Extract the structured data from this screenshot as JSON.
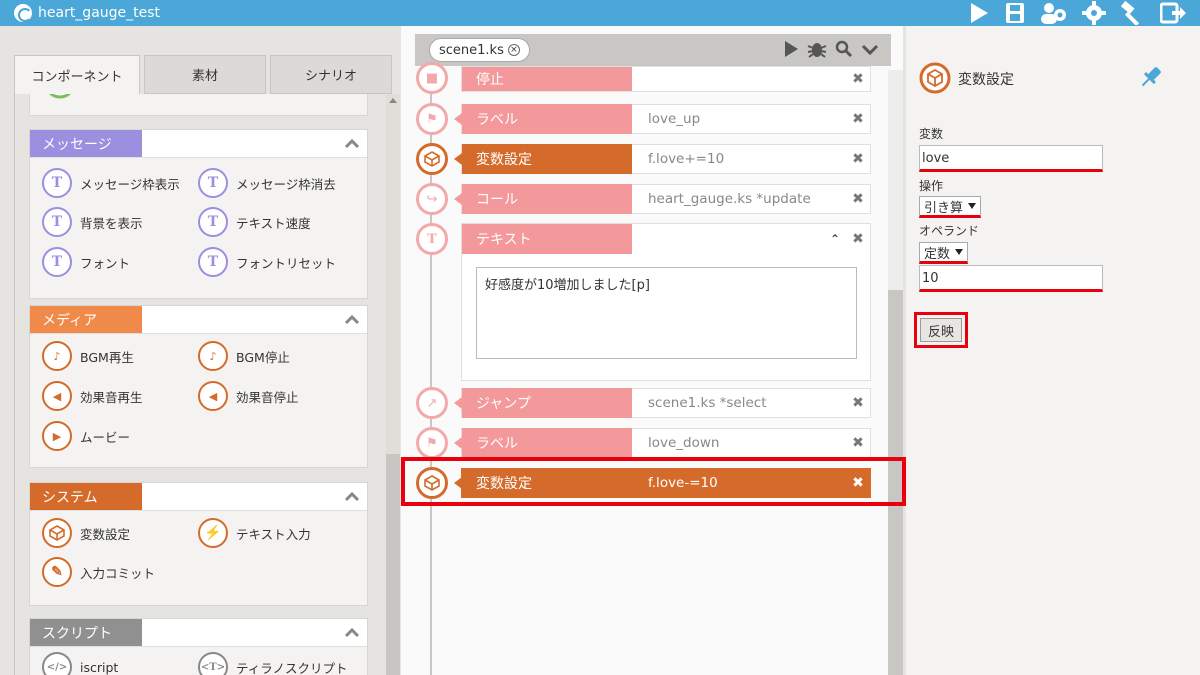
{
  "app": {
    "title": "heart_gauge_test"
  },
  "toolbar_icons": [
    "play-icon",
    "save-icon",
    "users-icon",
    "gear-icon",
    "hammer-icon",
    "export-icon"
  ],
  "left": {
    "tabs": [
      "コンポーネント",
      "素材",
      "シナリオ"
    ],
    "groups": [
      {
        "name": "message",
        "label": "メッセージ",
        "color": "#9b8fe0",
        "items": [
          "メッセージ枠表示",
          "メッセージ枠消去",
          "背景を表示",
          "テキスト速度",
          "フォント",
          "フォントリセット"
        ]
      },
      {
        "name": "media",
        "label": "メディア",
        "color": "#f08a4b",
        "items": [
          "BGM再生",
          "BGM停止",
          "効果音再生",
          "効果音停止",
          "ムービー"
        ]
      },
      {
        "name": "system",
        "label": "システム",
        "color": "#d56b2b",
        "items": [
          "変数設定",
          "テキスト入力",
          "入力コミット"
        ]
      },
      {
        "name": "script",
        "label": "スクリプト",
        "color": "#909090",
        "items": [
          "iscript",
          "ティラノスクリプト"
        ]
      }
    ]
  },
  "editor": {
    "file_tab": "scene1.ks",
    "rows": [
      {
        "label": "停止",
        "value": ""
      },
      {
        "label": "ラベル",
        "value": "love_up"
      },
      {
        "label": "変数設定",
        "value": "f.love+=10"
      },
      {
        "label": "コール",
        "value": "heart_gauge.ks *update"
      },
      {
        "label": "テキスト",
        "value": "好感度が10増加しました[p]"
      },
      {
        "label": "ジャンプ",
        "value": "scene1.ks *select"
      },
      {
        "label": "ラベル",
        "value": "love_down"
      },
      {
        "label": "変数設定",
        "value": "f.love-=10"
      }
    ]
  },
  "props": {
    "title": "変数設定",
    "variable_label": "変数",
    "variable_value": "love",
    "operation_label": "操作",
    "operation_value": "引き算",
    "operand_label": "オペランド",
    "operand_type": "定数",
    "operand_value": "10",
    "apply_label": "反映"
  },
  "colors": {
    "accent": "#4aa7d8",
    "pink": "#f3999b",
    "orange": "#d56b2b",
    "highlight": "#e8000d"
  }
}
